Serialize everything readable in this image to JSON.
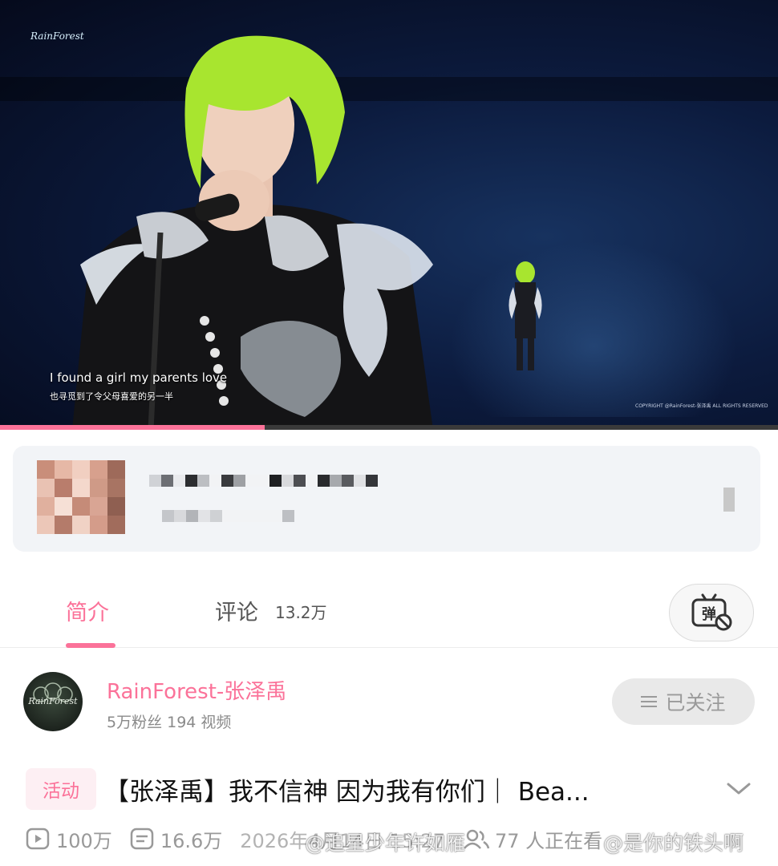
{
  "player": {
    "logo": "RainForest",
    "subtitle_en": "I found a girl my parents love",
    "subtitle_zh": "也寻觅到了令父母喜爱的另一半",
    "copyright": "COPYRIGHT @RainForest-张泽禹 ALL RIGHTS RESERVED",
    "progress_fraction": 0.34,
    "progress_color": "#fb7299"
  },
  "tabs": {
    "intro_label": "简介",
    "comment_label": "评论",
    "comment_count": "13.2万",
    "danmaku_icon": "danmaku-off-icon"
  },
  "uploader": {
    "avatar_text": "RainForest",
    "name": "RainForest-张泽禹",
    "stats": "5万粉丝   194 视频",
    "follow_label": "已关注"
  },
  "video": {
    "badge": "活动",
    "title": "【张泽禹】我不信神 因为我有你们｜ Bea...",
    "views": "100万",
    "danmaku": "16.6万",
    "datetime": "2026年4月14日 15:27",
    "watching": "77 人正在看"
  },
  "watermarks": {
    "left": "@追星少年许如雁",
    "right": "@是你的铁头啊"
  },
  "colors": {
    "accent": "#fb7299",
    "muted": "#999999"
  }
}
